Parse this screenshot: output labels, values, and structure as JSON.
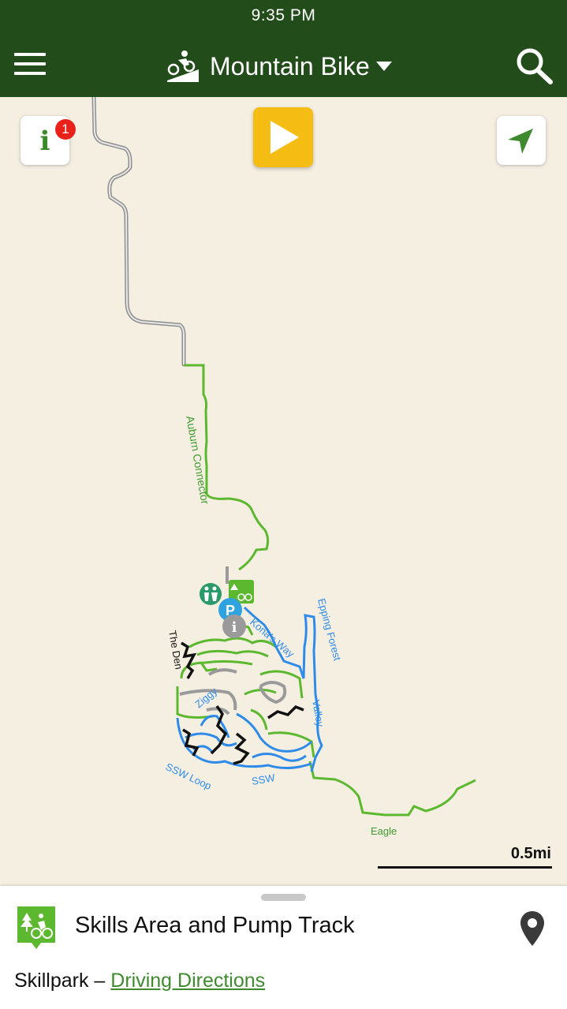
{
  "status_bar": {
    "time": "9:35 PM"
  },
  "header": {
    "title": "Mountain Bike",
    "menu_icon": "hamburger-menu-icon",
    "activity_icon": "mountain-bike-icon",
    "search_icon": "search-icon"
  },
  "map_controls": {
    "info_badge_count": "1",
    "info_icon": "info-icon",
    "play_icon": "play-icon",
    "locate_icon": "location-arrow-icon"
  },
  "trail_labels": {
    "auburn_connector": "Auburn Connector",
    "the_den": "The Den",
    "konas_way": "Kona's Way",
    "epping_forest": "Epping Forest",
    "ziggy": "Ziggy",
    "valley": "Valley",
    "ssw_loop": "SSW Loop",
    "ssw": "SSW",
    "eagle": "Eagle"
  },
  "scale": {
    "label": "0.5mi"
  },
  "colors": {
    "header": "#224c1a",
    "trail_green": "#5cb82e",
    "trail_blue": "#2f8be8",
    "trail_black": "#111111",
    "road_gray": "#9a9a9a",
    "play": "#f5bd13"
  },
  "bottom_sheet": {
    "place_name": "Skills Area and Pump Track",
    "place_icon": "trailhead-bike-icon",
    "pin_icon": "map-pin-icon",
    "category": "Skillpark",
    "separator": " – ",
    "directions_link": "Driving Directions"
  }
}
